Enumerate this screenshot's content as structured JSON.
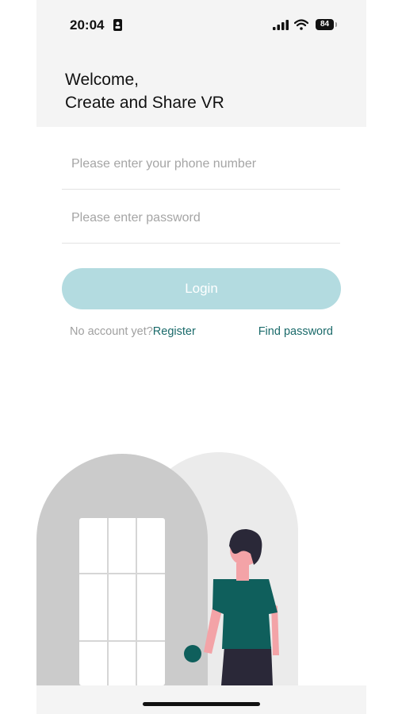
{
  "status_bar": {
    "time": "20:04",
    "battery": "84",
    "icons": [
      "id-card-icon",
      "cellular-signal-icon",
      "wifi-icon",
      "battery-icon"
    ]
  },
  "header": {
    "line1": "Welcome,",
    "line2": "Create and Share VR"
  },
  "form": {
    "phone_placeholder": "Please enter your phone number",
    "phone_value": "",
    "password_placeholder": "Please enter password",
    "password_value": "",
    "login_label": "Login"
  },
  "links": {
    "no_account": "No account yet?",
    "register": "Register",
    "find_password": "Find password"
  },
  "colors": {
    "accent": "#1a6a6a",
    "login_button": "#b3dbe0",
    "header_background": "#f4f4f4",
    "figure_shirt": "#0f5f5c"
  }
}
